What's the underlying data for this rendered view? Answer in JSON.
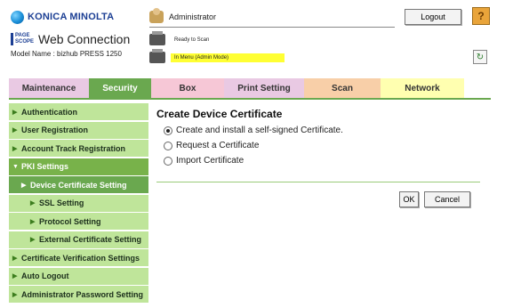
{
  "header": {
    "brand": "KONICA MINOLTA",
    "pagescope_logo": "PAGE SCOPE",
    "app_title": "Web Connection",
    "model_line": "Model Name : bizhub PRESS 1250",
    "user": "Administrator",
    "logout_label": "Logout",
    "help_label": "?",
    "status_ready": "Ready to Scan",
    "status_menu": "In Menu (Admin Mode)"
  },
  "tabs": [
    {
      "label": "Maintenance",
      "color": "#e9c9e3"
    },
    {
      "label": "Security",
      "color": "#6aa84f",
      "active": true
    },
    {
      "label": "Box",
      "color": "#f6c7d6"
    },
    {
      "label": "Print Setting",
      "color": "#e9c9e3"
    },
    {
      "label": "Scan",
      "color": "#f8cfa8"
    },
    {
      "label": "Network",
      "color": "#ffffb0"
    }
  ],
  "sidebar": {
    "items": [
      {
        "label": "Authentication",
        "level": 0
      },
      {
        "label": "User Registration",
        "level": 0
      },
      {
        "label": "Account Track Registration",
        "level": 0
      },
      {
        "label": "PKI Settings",
        "level": 0,
        "expanded": true
      },
      {
        "label": "Device Certificate Setting",
        "level": 1,
        "active": true
      },
      {
        "label": "SSL Setting",
        "level": 1
      },
      {
        "label": "Protocol Setting",
        "level": 1
      },
      {
        "label": "External Certificate Setting",
        "level": 1
      },
      {
        "label": "Certificate Verification Settings",
        "level": 0
      },
      {
        "label": "Auto Logout",
        "level": 0
      },
      {
        "label": "Administrator Password Setting",
        "level": 0
      }
    ]
  },
  "main": {
    "title": "Create Device Certificate",
    "options": [
      {
        "label": "Create and install a self-signed Certificate.",
        "checked": true
      },
      {
        "label": "Request a Certificate",
        "checked": false
      },
      {
        "label": "Import Certificate",
        "checked": false
      }
    ],
    "ok_label": "OK",
    "cancel_label": "Cancel"
  },
  "colors": {
    "accent_green": "#6aa84f",
    "sidebar_green": "#bfe59a",
    "status_highlight": "#ffff33"
  }
}
